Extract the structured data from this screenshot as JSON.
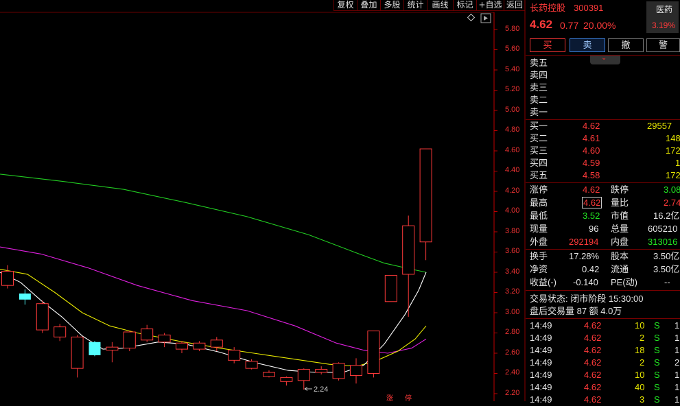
{
  "toolbar": [
    "复权",
    "叠加",
    "多股",
    "统计",
    "画线",
    "标记",
    "+自选",
    "返回"
  ],
  "chart": {
    "y_ticks": [
      "5.80",
      "5.60",
      "5.40",
      "5.20",
      "5.00",
      "4.80",
      "4.60",
      "4.40",
      "4.20",
      "4.00",
      "3.80",
      "3.60",
      "3.40",
      "3.20",
      "3.00",
      "2.80",
      "2.60",
      "2.40",
      "2.20"
    ],
    "low_marker": "2.24",
    "bottom_labels": [
      "涨",
      "停"
    ],
    "corner_icon": "diamond-icon"
  },
  "chart_data": {
    "type": "candlestick",
    "ylim": [
      2.2,
      5.9
    ],
    "candles": [
      {
        "o": 3.27,
        "c": 3.41,
        "h": 3.47,
        "l": 3.24
      },
      {
        "o": 3.19,
        "c": 3.13,
        "h": 3.23,
        "l": 3.08
      },
      {
        "o": 2.83,
        "c": 3.09,
        "h": 3.12,
        "l": 2.8
      },
      {
        "o": 2.76,
        "c": 2.86,
        "h": 2.89,
        "l": 2.72
      },
      {
        "o": 2.45,
        "c": 2.76,
        "h": 2.78,
        "l": 2.36
      },
      {
        "o": 2.71,
        "c": 2.58,
        "h": 2.72,
        "l": 2.57
      },
      {
        "o": 2.63,
        "c": 2.66,
        "h": 2.71,
        "l": 2.51
      },
      {
        "o": 2.65,
        "c": 2.81,
        "h": 2.82,
        "l": 2.62
      },
      {
        "o": 2.73,
        "c": 2.84,
        "h": 2.88,
        "l": 2.71
      },
      {
        "o": 2.71,
        "c": 2.78,
        "h": 2.8,
        "l": 2.66
      },
      {
        "o": 2.64,
        "c": 2.7,
        "h": 2.72,
        "l": 2.6
      },
      {
        "o": 2.64,
        "c": 2.7,
        "h": 2.72,
        "l": 2.62
      },
      {
        "o": 2.66,
        "c": 2.73,
        "h": 2.76,
        "l": 2.62
      },
      {
        "o": 2.53,
        "c": 2.63,
        "h": 2.66,
        "l": 2.5
      },
      {
        "o": 2.45,
        "c": 2.52,
        "h": 2.54,
        "l": 2.44
      },
      {
        "o": 2.37,
        "c": 2.41,
        "h": 2.43,
        "l": 2.36
      },
      {
        "o": 2.32,
        "c": 2.36,
        "h": 2.37,
        "l": 2.28
      },
      {
        "o": 2.33,
        "c": 2.44,
        "h": 2.45,
        "l": 2.24
      },
      {
        "o": 2.41,
        "c": 2.44,
        "h": 2.47,
        "l": 2.39
      },
      {
        "o": 2.35,
        "c": 2.5,
        "h": 2.51,
        "l": 2.33
      },
      {
        "o": 2.38,
        "c": 2.48,
        "h": 2.55,
        "l": 2.3
      },
      {
        "o": 2.4,
        "c": 2.82,
        "h": 2.82,
        "l": 2.36
      },
      {
        "o": 3.11,
        "c": 3.37,
        "h": 3.37,
        "l": 3.11
      },
      {
        "o": 3.38,
        "c": 3.86,
        "h": 3.96,
        "l": 2.96
      },
      {
        "o": 3.7,
        "c": 4.62,
        "h": 4.62,
        "l": 3.52
      }
    ],
    "ma_green": [
      [
        0,
        4.37
      ],
      [
        90,
        4.3
      ],
      [
        180,
        4.22
      ],
      [
        270,
        4.09
      ],
      [
        360,
        3.95
      ],
      [
        450,
        3.77
      ],
      [
        520,
        3.59
      ],
      [
        560,
        3.49
      ],
      [
        600,
        3.43
      ],
      [
        621,
        3.4
      ]
    ],
    "ma_magenta": [
      [
        0,
        3.65
      ],
      [
        60,
        3.58
      ],
      [
        130,
        3.44
      ],
      [
        200,
        3.27
      ],
      [
        280,
        3.12
      ],
      [
        360,
        3.02
      ],
      [
        430,
        2.87
      ],
      [
        490,
        2.7
      ],
      [
        530,
        2.63
      ],
      [
        565,
        2.6
      ],
      [
        600,
        2.65
      ],
      [
        621,
        2.74
      ]
    ],
    "ma_yellow": [
      [
        0,
        3.43
      ],
      [
        40,
        3.38
      ],
      [
        80,
        3.2
      ],
      [
        120,
        3.0
      ],
      [
        160,
        2.87
      ],
      [
        200,
        2.8
      ],
      [
        260,
        2.72
      ],
      [
        320,
        2.65
      ],
      [
        380,
        2.59
      ],
      [
        440,
        2.53
      ],
      [
        480,
        2.49
      ],
      [
        520,
        2.47
      ],
      [
        550,
        2.53
      ],
      [
        580,
        2.62
      ],
      [
        605,
        2.74
      ],
      [
        621,
        2.87
      ]
    ],
    "ma_white": [
      [
        0,
        3.4
      ],
      [
        30,
        3.3
      ],
      [
        60,
        3.12
      ],
      [
        90,
        2.96
      ],
      [
        120,
        2.77
      ],
      [
        150,
        2.64
      ],
      [
        180,
        2.65
      ],
      [
        230,
        2.71
      ],
      [
        270,
        2.69
      ],
      [
        320,
        2.61
      ],
      [
        370,
        2.51
      ],
      [
        420,
        2.43
      ],
      [
        460,
        2.41
      ],
      [
        500,
        2.41
      ],
      [
        530,
        2.48
      ],
      [
        560,
        2.69
      ],
      [
        590,
        2.98
      ],
      [
        610,
        3.22
      ],
      [
        621,
        3.4
      ]
    ]
  },
  "stock": {
    "name": "长药控股",
    "code": "300391",
    "price": "4.62",
    "change": "0.77",
    "change_pct": "20.00%",
    "sector": "医药",
    "sector_pct": "3.19%"
  },
  "trade_buttons": [
    "买",
    "卖",
    "撤",
    "警"
  ],
  "sell_levels": [
    {
      "label": "卖五",
      "price": "",
      "vol": ""
    },
    {
      "label": "卖四",
      "price": "",
      "vol": ""
    },
    {
      "label": "卖三",
      "price": "",
      "vol": ""
    },
    {
      "label": "卖二",
      "price": "",
      "vol": ""
    },
    {
      "label": "卖一",
      "price": "",
      "vol": ""
    }
  ],
  "buy_levels": [
    {
      "label": "买一",
      "price": "4.62",
      "vol": "29557"
    },
    {
      "label": "买二",
      "price": "4.61",
      "vol": "148"
    },
    {
      "label": "买三",
      "price": "4.60",
      "vol": "172"
    },
    {
      "label": "买四",
      "price": "4.59",
      "vol": "1"
    },
    {
      "label": "买五",
      "price": "4.58",
      "vol": "172"
    }
  ],
  "stats": [
    {
      "l1": "涨停",
      "v1": "4.62",
      "l2": "跌停",
      "v2": "3.08"
    },
    {
      "l1": "最高",
      "v1": "4.62",
      "l2": "量比",
      "v2": "2.74"
    },
    {
      "l1": "最低",
      "v1": "3.52",
      "l2": "市值",
      "v2": "16.2亿"
    },
    {
      "l1": "现量",
      "v1": "96",
      "l2": "总量",
      "v2": "605210"
    },
    {
      "l1": "外盘",
      "v1": "292194",
      "l2": "内盘",
      "v2": "313016"
    }
  ],
  "stats2": [
    {
      "l1": "换手",
      "v1": "17.28%",
      "l2": "股本",
      "v2": "3.50亿"
    },
    {
      "l1": "净资",
      "v1": "0.42",
      "l2": "流通",
      "v2": "3.50亿"
    },
    {
      "l1": "收益(-)",
      "v1": "-0.140",
      "l2": "PE(动)",
      "v2": "--"
    }
  ],
  "status_line": "交易状态: 闭市阶段 15:30:00",
  "after_hours_line": "盘后交易量 87 额 4.0万",
  "ticks": [
    {
      "time": "14:49",
      "price": "4.62",
      "vol": "10",
      "side": "S",
      "extra": "1"
    },
    {
      "time": "14:49",
      "price": "4.62",
      "vol": "2",
      "side": "S",
      "extra": "1"
    },
    {
      "time": "14:49",
      "price": "4.62",
      "vol": "18",
      "side": "S",
      "extra": "1"
    },
    {
      "time": "14:49",
      "price": "4.62",
      "vol": "2",
      "side": "S",
      "extra": "2"
    },
    {
      "time": "14:49",
      "price": "4.62",
      "vol": "10",
      "side": "S",
      "extra": "1"
    },
    {
      "time": "14:49",
      "price": "4.62",
      "vol": "40",
      "side": "S",
      "extra": "1"
    },
    {
      "time": "14:49",
      "price": "4.62",
      "vol": "3",
      "side": "S",
      "extra": "1"
    }
  ],
  "colors": {
    "up": "#ff3a3a",
    "down_body": "#54ffff",
    "ma_green": "#22cc22",
    "ma_magenta": "#e020e0",
    "ma_yellow": "#e8e800",
    "ma_white": "#ffffff"
  }
}
